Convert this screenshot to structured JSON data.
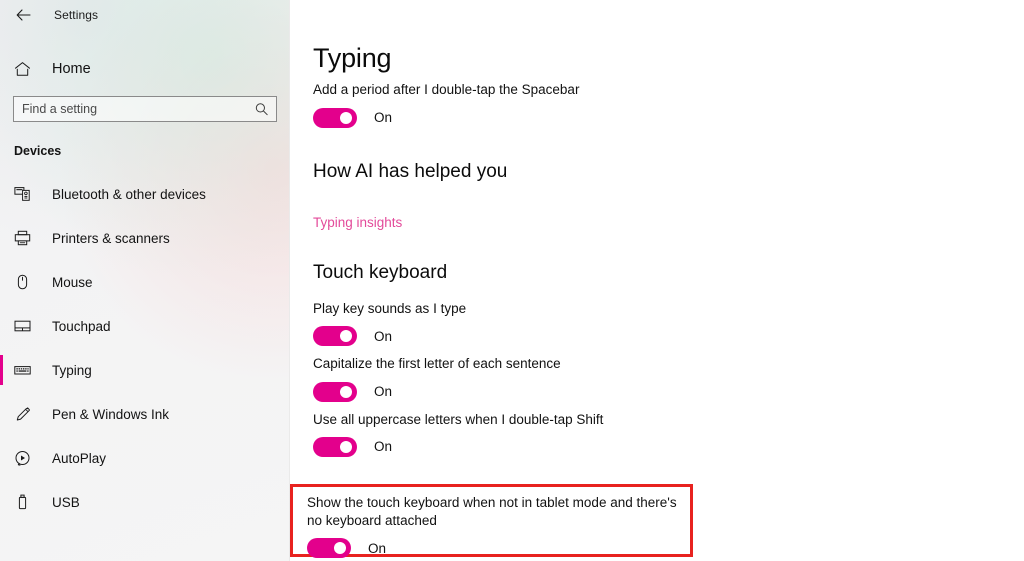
{
  "window": {
    "title": "Settings",
    "back_icon": "back-arrow-icon"
  },
  "sidebar": {
    "home": {
      "label": "Home",
      "icon": "home-icon"
    },
    "search": {
      "placeholder": "Find a setting",
      "value": "",
      "icon": "search-icon"
    },
    "group_title": "Devices",
    "items": [
      {
        "label": "Bluetooth & other devices",
        "icon": "bluetooth-devices-icon",
        "selected": false
      },
      {
        "label": "Printers & scanners",
        "icon": "printer-icon",
        "selected": false
      },
      {
        "label": "Mouse",
        "icon": "mouse-icon",
        "selected": false
      },
      {
        "label": "Touchpad",
        "icon": "touchpad-icon",
        "selected": false
      },
      {
        "label": "Typing",
        "icon": "keyboard-icon",
        "selected": true
      },
      {
        "label": "Pen & Windows Ink",
        "icon": "pen-icon",
        "selected": false
      },
      {
        "label": "AutoPlay",
        "icon": "autoplay-icon",
        "selected": false
      },
      {
        "label": "USB",
        "icon": "usb-icon",
        "selected": false
      }
    ]
  },
  "main": {
    "page_title": "Typing",
    "settings": {
      "spacebar_period": {
        "label": "Add a period after I double-tap the Spacebar",
        "state": "On"
      },
      "ai_section_title": "How AI has helped you",
      "typing_insights_link": "Typing insights",
      "touch_keyboard_title": "Touch keyboard",
      "key_sounds": {
        "label": "Play key sounds as I type",
        "state": "On"
      },
      "capitalize": {
        "label": "Capitalize the first letter of each sentence",
        "state": "On"
      },
      "uppercase_shift": {
        "label": "Use all uppercase letters when I double-tap Shift",
        "state": "On"
      },
      "show_touch_keyboard": {
        "label": "Show the touch keyboard when not in tablet mode and there's no keyboard attached",
        "state": "On"
      }
    }
  },
  "colors": {
    "accent": "#e3008c",
    "link": "#e34a9a",
    "highlight_border": "#e8221f",
    "text": "#121212"
  }
}
